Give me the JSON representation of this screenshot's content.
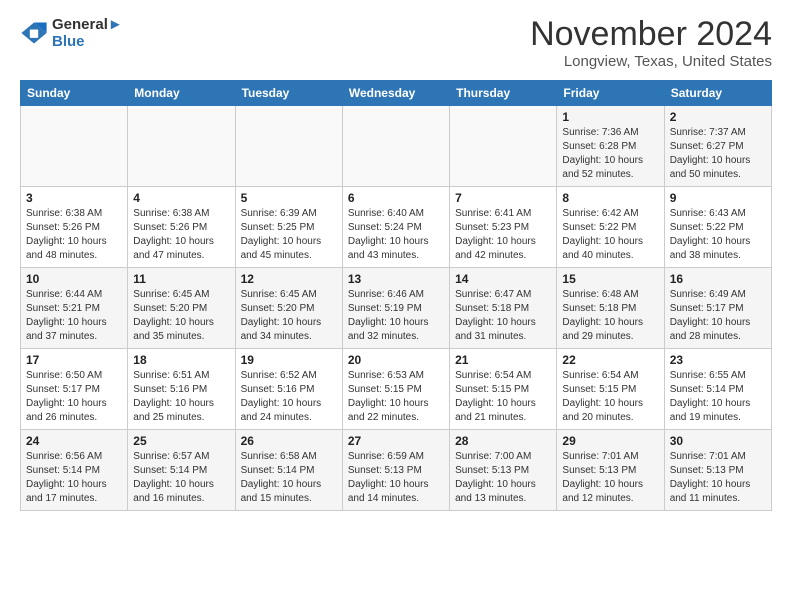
{
  "header": {
    "logo_line1": "General",
    "logo_line2": "Blue",
    "month": "November 2024",
    "location": "Longview, Texas, United States"
  },
  "weekdays": [
    "Sunday",
    "Monday",
    "Tuesday",
    "Wednesday",
    "Thursday",
    "Friday",
    "Saturday"
  ],
  "weeks": [
    [
      {
        "day": "",
        "info": ""
      },
      {
        "day": "",
        "info": ""
      },
      {
        "day": "",
        "info": ""
      },
      {
        "day": "",
        "info": ""
      },
      {
        "day": "",
        "info": ""
      },
      {
        "day": "1",
        "info": "Sunrise: 7:36 AM\nSunset: 6:28 PM\nDaylight: 10 hours\nand 52 minutes."
      },
      {
        "day": "2",
        "info": "Sunrise: 7:37 AM\nSunset: 6:27 PM\nDaylight: 10 hours\nand 50 minutes."
      }
    ],
    [
      {
        "day": "3",
        "info": "Sunrise: 6:38 AM\nSunset: 5:26 PM\nDaylight: 10 hours\nand 48 minutes."
      },
      {
        "day": "4",
        "info": "Sunrise: 6:38 AM\nSunset: 5:26 PM\nDaylight: 10 hours\nand 47 minutes."
      },
      {
        "day": "5",
        "info": "Sunrise: 6:39 AM\nSunset: 5:25 PM\nDaylight: 10 hours\nand 45 minutes."
      },
      {
        "day": "6",
        "info": "Sunrise: 6:40 AM\nSunset: 5:24 PM\nDaylight: 10 hours\nand 43 minutes."
      },
      {
        "day": "7",
        "info": "Sunrise: 6:41 AM\nSunset: 5:23 PM\nDaylight: 10 hours\nand 42 minutes."
      },
      {
        "day": "8",
        "info": "Sunrise: 6:42 AM\nSunset: 5:22 PM\nDaylight: 10 hours\nand 40 minutes."
      },
      {
        "day": "9",
        "info": "Sunrise: 6:43 AM\nSunset: 5:22 PM\nDaylight: 10 hours\nand 38 minutes."
      }
    ],
    [
      {
        "day": "10",
        "info": "Sunrise: 6:44 AM\nSunset: 5:21 PM\nDaylight: 10 hours\nand 37 minutes."
      },
      {
        "day": "11",
        "info": "Sunrise: 6:45 AM\nSunset: 5:20 PM\nDaylight: 10 hours\nand 35 minutes."
      },
      {
        "day": "12",
        "info": "Sunrise: 6:45 AM\nSunset: 5:20 PM\nDaylight: 10 hours\nand 34 minutes."
      },
      {
        "day": "13",
        "info": "Sunrise: 6:46 AM\nSunset: 5:19 PM\nDaylight: 10 hours\nand 32 minutes."
      },
      {
        "day": "14",
        "info": "Sunrise: 6:47 AM\nSunset: 5:18 PM\nDaylight: 10 hours\nand 31 minutes."
      },
      {
        "day": "15",
        "info": "Sunrise: 6:48 AM\nSunset: 5:18 PM\nDaylight: 10 hours\nand 29 minutes."
      },
      {
        "day": "16",
        "info": "Sunrise: 6:49 AM\nSunset: 5:17 PM\nDaylight: 10 hours\nand 28 minutes."
      }
    ],
    [
      {
        "day": "17",
        "info": "Sunrise: 6:50 AM\nSunset: 5:17 PM\nDaylight: 10 hours\nand 26 minutes."
      },
      {
        "day": "18",
        "info": "Sunrise: 6:51 AM\nSunset: 5:16 PM\nDaylight: 10 hours\nand 25 minutes."
      },
      {
        "day": "19",
        "info": "Sunrise: 6:52 AM\nSunset: 5:16 PM\nDaylight: 10 hours\nand 24 minutes."
      },
      {
        "day": "20",
        "info": "Sunrise: 6:53 AM\nSunset: 5:15 PM\nDaylight: 10 hours\nand 22 minutes."
      },
      {
        "day": "21",
        "info": "Sunrise: 6:54 AM\nSunset: 5:15 PM\nDaylight: 10 hours\nand 21 minutes."
      },
      {
        "day": "22",
        "info": "Sunrise: 6:54 AM\nSunset: 5:15 PM\nDaylight: 10 hours\nand 20 minutes."
      },
      {
        "day": "23",
        "info": "Sunrise: 6:55 AM\nSunset: 5:14 PM\nDaylight: 10 hours\nand 19 minutes."
      }
    ],
    [
      {
        "day": "24",
        "info": "Sunrise: 6:56 AM\nSunset: 5:14 PM\nDaylight: 10 hours\nand 17 minutes."
      },
      {
        "day": "25",
        "info": "Sunrise: 6:57 AM\nSunset: 5:14 PM\nDaylight: 10 hours\nand 16 minutes."
      },
      {
        "day": "26",
        "info": "Sunrise: 6:58 AM\nSunset: 5:14 PM\nDaylight: 10 hours\nand 15 minutes."
      },
      {
        "day": "27",
        "info": "Sunrise: 6:59 AM\nSunset: 5:13 PM\nDaylight: 10 hours\nand 14 minutes."
      },
      {
        "day": "28",
        "info": "Sunrise: 7:00 AM\nSunset: 5:13 PM\nDaylight: 10 hours\nand 13 minutes."
      },
      {
        "day": "29",
        "info": "Sunrise: 7:01 AM\nSunset: 5:13 PM\nDaylight: 10 hours\nand 12 minutes."
      },
      {
        "day": "30",
        "info": "Sunrise: 7:01 AM\nSunset: 5:13 PM\nDaylight: 10 hours\nand 11 minutes."
      }
    ]
  ]
}
